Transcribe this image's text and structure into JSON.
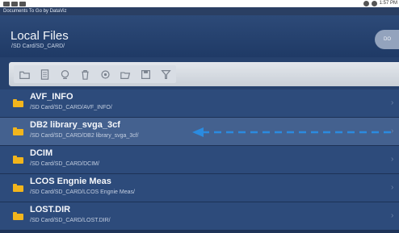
{
  "status_bar": {
    "time": "1:57 PM",
    "left_icons": [
      "usb-icon",
      "sd-card-icon",
      "download-icon"
    ],
    "right_icons": [
      "wifi-icon",
      "battery-icon"
    ]
  },
  "app": {
    "banner": "Documents To Go by DataViz",
    "title": "Local Files",
    "path": "/SD Card/SD_CARD/",
    "logo_text": "DO"
  },
  "toolbar": {
    "buttons": [
      {
        "name": "new-folder-icon"
      },
      {
        "name": "new-document-icon"
      },
      {
        "name": "search-icon"
      },
      {
        "name": "delete-icon"
      },
      {
        "name": "settings-icon"
      },
      {
        "name": "open-folder-icon"
      },
      {
        "name": "save-icon"
      },
      {
        "name": "filter-icon"
      }
    ]
  },
  "files": [
    {
      "name": "AVF_INFO",
      "path": "/SD Card/SD_CARD/AVF_INFO/",
      "selected": false
    },
    {
      "name": "DB2 library_svga_3cf",
      "path": "/SD Card/SD_CARD/DB2 library_svga_3cf/",
      "selected": true
    },
    {
      "name": "DCIM",
      "path": "/SD Card/SD_CARD/DCIM/",
      "selected": false
    },
    {
      "name": "LCOS Engnie Meas",
      "path": "/SD Card/SD_CARD/LCOS Engnie Meas/",
      "selected": false
    },
    {
      "name": "LOST.DIR",
      "path": "/SD Card/SD_CARD/LOST.DIR/",
      "selected": false
    }
  ],
  "colors": {
    "header": "#2d4a78",
    "row": "#2d4b7b",
    "row_selected": "#44618f",
    "folder": "#f2b51c",
    "arrow": "#2b8be0"
  }
}
